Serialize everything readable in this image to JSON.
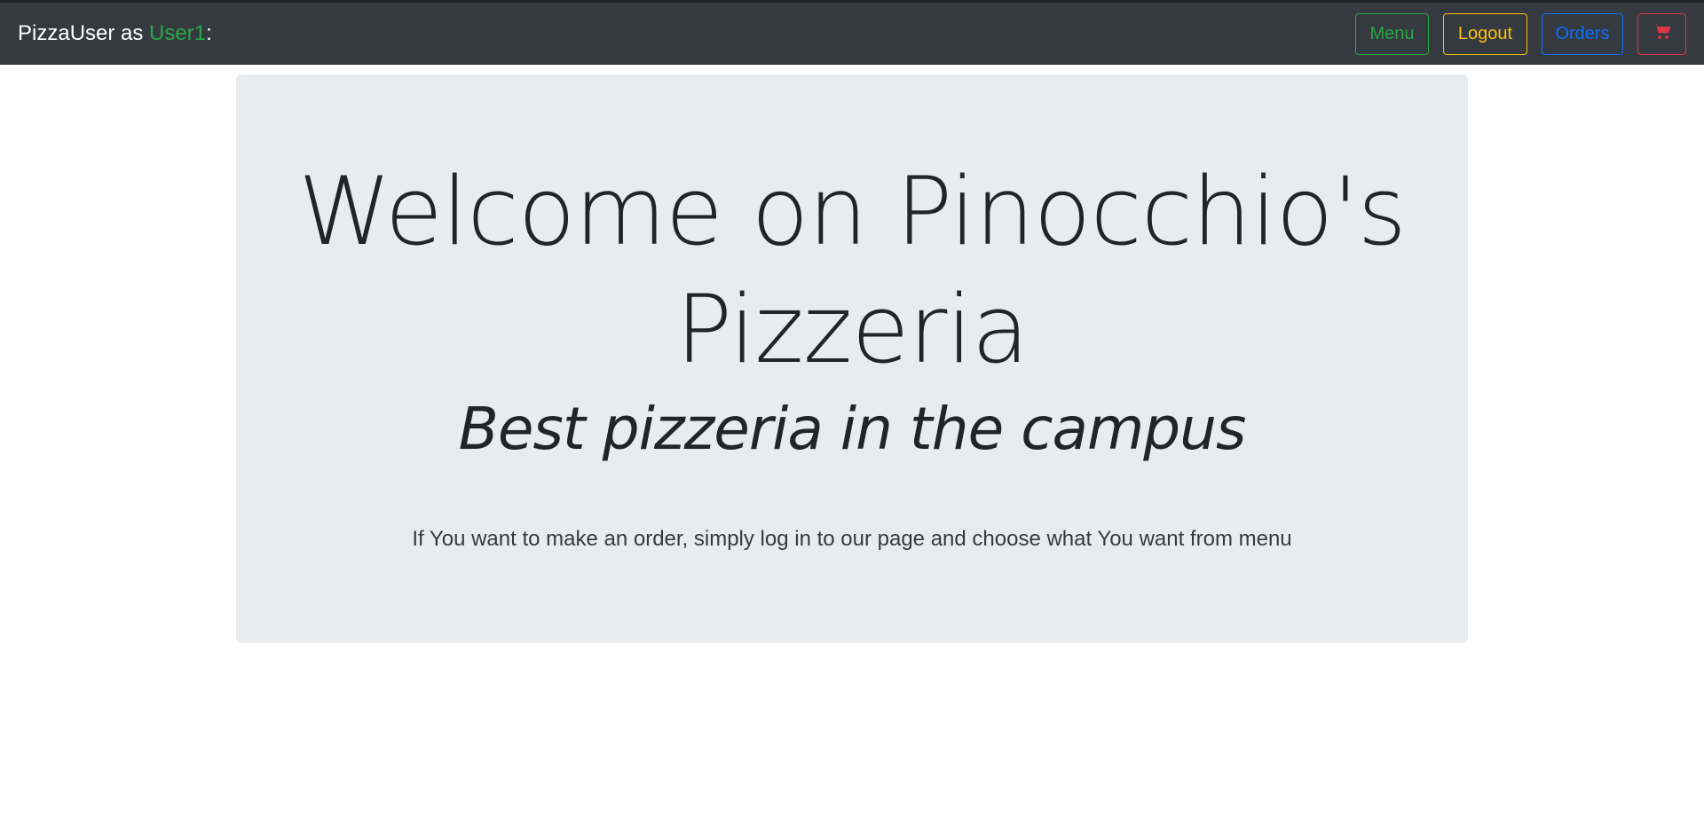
{
  "navbar": {
    "brand_prefix": "PizzaUser as ",
    "username": "User1",
    "brand_suffix": ":",
    "buttons": {
      "menu": "Menu",
      "logout": "Logout",
      "orders": "Orders",
      "cart_icon": "shopping-cart-icon"
    }
  },
  "hero": {
    "title": "Welcome on Pinocchio's Pizzeria",
    "subtitle": "Best pizzeria in the campus",
    "description": "If You want to make an order, simply log in to our page and choose what You want from menu"
  },
  "colors": {
    "navbar_bg": "#343a40",
    "jumbotron_bg": "#e9ecef",
    "success": "#28a745",
    "warning": "#ffc107",
    "primary": "#0d6efd",
    "danger": "#dc3545"
  }
}
